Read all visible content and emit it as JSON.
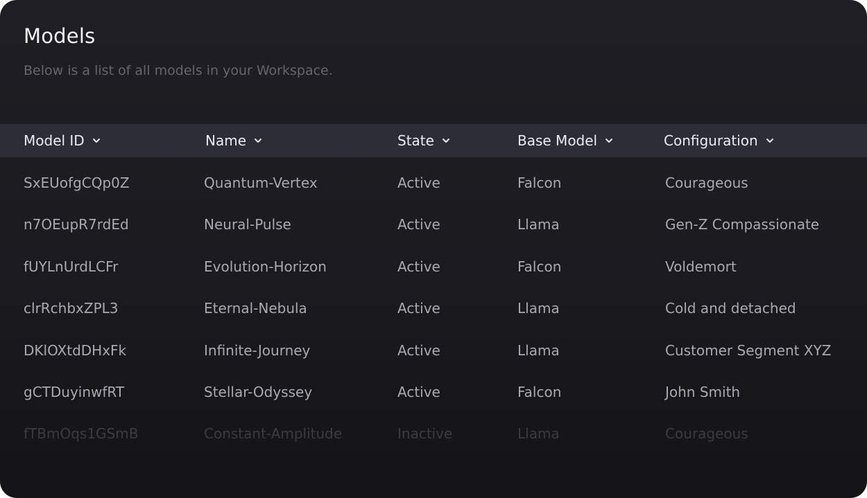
{
  "page": {
    "title": "Models",
    "subtitle": "Below is a list of all models in your Workspace."
  },
  "table": {
    "columns": [
      {
        "label": "Model ID",
        "icon": "chevron-down-icon"
      },
      {
        "label": "Name",
        "icon": "chevron-down-icon"
      },
      {
        "label": "State",
        "icon": "chevron-down-icon"
      },
      {
        "label": "Base Model",
        "icon": "chevron-down-icon"
      },
      {
        "label": "Configuration",
        "icon": "chevron-down-icon"
      }
    ],
    "rows": [
      {
        "id": "SxEUofgCQp0Z",
        "name": "Quantum-Vertex",
        "state": "Active",
        "base": "Falcon",
        "config": "Courageous"
      },
      {
        "id": "n7OEupR7rdEd",
        "name": "Neural-Pulse",
        "state": "Active",
        "base": "Llama",
        "config": "Gen-Z Compassionate"
      },
      {
        "id": "fUYLnUrdLCFr",
        "name": "Evolution-Horizon",
        "state": "Active",
        "base": "Falcon",
        "config": "Voldemort"
      },
      {
        "id": "clrRchbxZPL3",
        "name": "Eternal-Nebula",
        "state": "Active",
        "base": "Llama",
        "config": "Cold and detached"
      },
      {
        "id": "DKlOXtdDHxFk",
        "name": "Infinite-Journey",
        "state": "Active",
        "base": "Llama",
        "config": "Customer Segment XYZ"
      },
      {
        "id": "gCTDuyinwfRT",
        "name": "Stellar-Odyssey",
        "state": "Active",
        "base": "Falcon",
        "config": "John Smith"
      },
      {
        "id": "fTBmOqs1GSmB",
        "name": "Constant-Amplitude",
        "state": "Inactive",
        "base": "Llama",
        "config": "Courageous"
      }
    ]
  },
  "colors": {
    "panel_background": "#1a1a1f",
    "header_background": "#2d2d38",
    "title_text": "#f2f2f5",
    "subtitle_text": "#65656e",
    "cell_text": "#a9a9b0",
    "inactive_text": "#3d3d44"
  }
}
